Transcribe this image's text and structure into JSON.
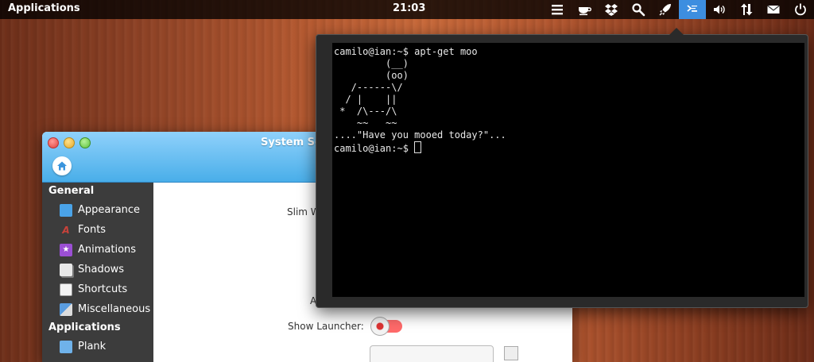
{
  "panel": {
    "apps_label": "Applications",
    "clock": "21:03",
    "indicators": [
      {
        "icon": "menu-icon"
      },
      {
        "icon": "coffee-cup-icon"
      },
      {
        "icon": "dropbox-icon"
      },
      {
        "icon": "search-icon"
      },
      {
        "icon": "rocket-icon"
      },
      {
        "icon": "terminal-icon",
        "active": true
      },
      {
        "icon": "volume-icon"
      },
      {
        "icon": "network-icon"
      },
      {
        "icon": "mail-icon"
      },
      {
        "icon": "power-icon"
      }
    ]
  },
  "settings": {
    "title": "System Set",
    "sidebar": {
      "section_general": "General",
      "section_applications": "Applications",
      "items": [
        {
          "label": "Appearance",
          "icon": "appearance-icon",
          "color": "#4aa3e8"
        },
        {
          "label": "Fonts",
          "icon": "fonts-icon",
          "color": "#c8423a"
        },
        {
          "label": "Animations",
          "icon": "animations-icon",
          "color": "#9b4fd4"
        },
        {
          "label": "Shadows",
          "icon": "shadows-icon",
          "color": "#e8e8e8"
        },
        {
          "label": "Shortcuts",
          "icon": "shortcuts-icon",
          "color": "#f2f2f2"
        },
        {
          "label": "Miscellaneous",
          "icon": "miscellaneous-icon",
          "color": "#5a9de0"
        },
        {
          "label": "Plank",
          "icon": "plank-icon",
          "color": "#6fb2ea"
        }
      ]
    },
    "content": {
      "slim_label": "Slim W",
      "a_label": "A",
      "show_launcher_label": "Show Launcher:"
    }
  },
  "terminal": {
    "lines": [
      "camilo@ian:~$ apt-get moo",
      "         (__)",
      "         (oo)",
      "   /------\\/",
      "  / |    ||",
      " *  /\\---/\\",
      "    ~~   ~~",
      "....\"Have you mooed today?\"..."
    ],
    "prompt": "camilo@ian:~$ "
  }
}
